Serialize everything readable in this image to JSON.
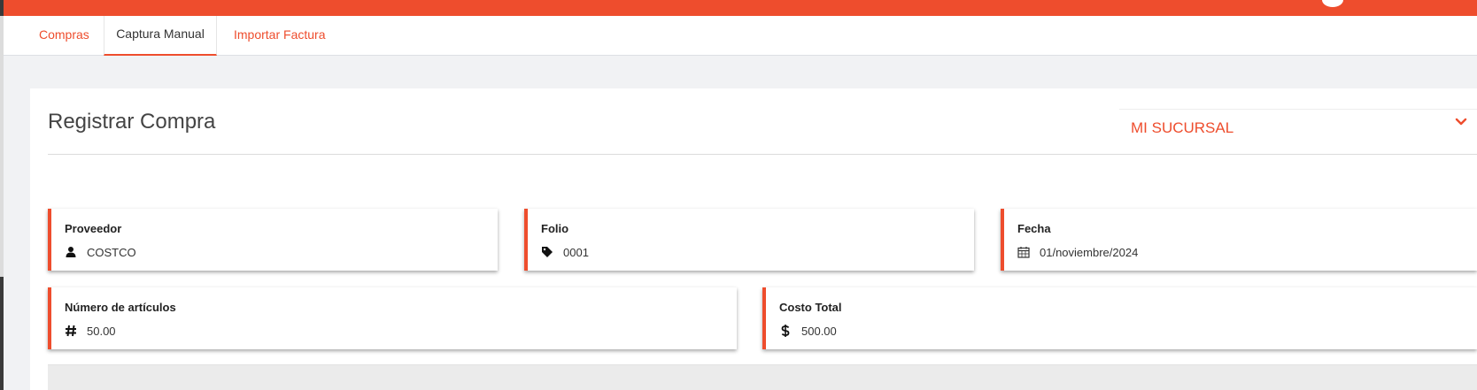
{
  "tabs": [
    {
      "label": "Compras"
    },
    {
      "label": "Captura Manual"
    },
    {
      "label": "Importar Factura"
    }
  ],
  "card": {
    "title": "Registrar Compra",
    "branch": {
      "label": "MI SUCURSAL",
      "icon": "chevron-down-icon"
    }
  },
  "fields": {
    "proveedor": {
      "label": "Proveedor",
      "value": "COSTCO",
      "icon": "user-icon"
    },
    "folio": {
      "label": "Folio",
      "value": "0001",
      "icon": "tag-icon"
    },
    "fecha": {
      "label": "Fecha",
      "value": "01/noviembre/2024",
      "icon": "calendar-icon"
    },
    "articulos": {
      "label": "Número de artículos",
      "value": "50.00",
      "icon": "hash-icon"
    },
    "costo": {
      "label": "Costo Total",
      "value": "500.00",
      "icon": "dollar-icon"
    }
  },
  "colors": {
    "accent": "#ee4d2d",
    "background": "#f1f2f4"
  }
}
